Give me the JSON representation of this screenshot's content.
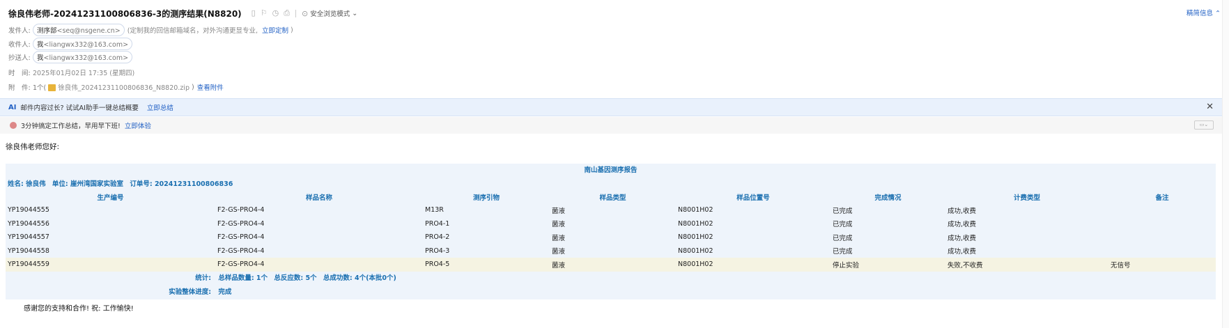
{
  "email": {
    "subject": "徐良伟老师-20241231100806836-3的测序结果(N8820)",
    "safe_mode": "安全浏览模式",
    "summary_toggle": "精简信息",
    "from": {
      "label": "发件人:",
      "name": "测序部",
      "addr": "<seq@nsgene.cn>",
      "note": "(定制我的回信邮箱域名，对外沟通更显专业,",
      "link": "立即定制",
      "close": ")"
    },
    "to": {
      "label": "收件人:",
      "name": "我",
      "addr": "<liangwx332@163.com>"
    },
    "cc": {
      "label": "抄送人:",
      "name": "我",
      "addr": "<liangwx332@163.com>"
    },
    "time": {
      "label": "时　间:",
      "value": "2025年01月02日 17:35 (星期四)"
    },
    "attachment": {
      "label": "附　件:",
      "count": "1个(",
      "file": "徐良伟_20241231100806836_N8820.zip",
      "close": ")",
      "view": "查看附件"
    }
  },
  "ai_bar": {
    "tag": "AI",
    "text": "邮件内容过长? 试试AI助手一键总结概要",
    "link": "立即总结"
  },
  "promo_bar": {
    "text": "3分钟搞定工作总结，早用早下班!",
    "link": "立即体验"
  },
  "body": {
    "greeting": "徐良伟老师您好:",
    "report": {
      "title": "南山基因测序报告",
      "info": {
        "name": "姓名: 徐良伟",
        "unit": "单位: 崖州湾国家实验室",
        "order": "订单号: 20241231100806836"
      },
      "columns": [
        "生产编号",
        "样品名称",
        "测序引物",
        "样品类型",
        "样品位置号",
        "完成情况",
        "计费类型",
        "备注"
      ],
      "rows": [
        [
          "YP19044555",
          "F2-GS-PRO4-4",
          "M13R",
          "菌液",
          "N8001H02",
          "已完成",
          "成功,收费",
          ""
        ],
        [
          "YP19044556",
          "F2-GS-PRO4-4",
          "PRO4-1",
          "菌液",
          "N8001H02",
          "已完成",
          "成功,收费",
          ""
        ],
        [
          "YP19044557",
          "F2-GS-PRO4-4",
          "PRO4-2",
          "菌液",
          "N8001H02",
          "已完成",
          "成功,收费",
          ""
        ],
        [
          "YP19044558",
          "F2-GS-PRO4-4",
          "PRO4-3",
          "菌液",
          "N8001H02",
          "已完成",
          "成功,收费",
          ""
        ],
        [
          "YP19044559",
          "F2-GS-PRO4-4",
          "PRO4-5",
          "菌液",
          "N8001H02",
          "停止实验",
          "失败,不收费",
          "无信号"
        ]
      ],
      "stats": {
        "label": "统计:",
        "samples": "总样品数量: 1个",
        "reactions": "总反应数: 5个",
        "success": "总成功数: 4个(本批0个)"
      },
      "progress": {
        "label": "实验整体进度:",
        "value": "完成"
      }
    },
    "closing": "感谢您的支持和合作! 祝: 工作愉快!"
  }
}
